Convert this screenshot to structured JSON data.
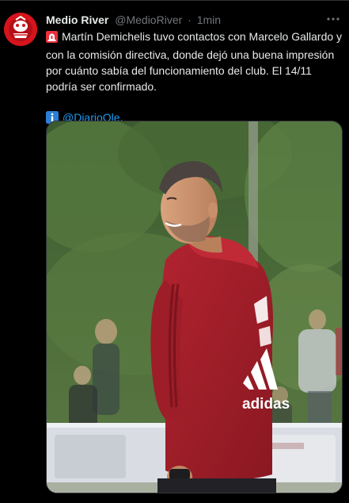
{
  "tweet": {
    "author": {
      "display_name": "Medio River",
      "handle": "@MedioRiver"
    },
    "separator": "·",
    "timestamp": "1min",
    "paragraph_1": "Martín Demichelis tuvo contactos con Marcelo Gallardo y con la comisión directiva, donde dejó una buena impresión por cuánto sabía del funcionamiento del club. El 14/11 podría ser confirmado.",
    "mention": "@DiarioOle",
    "mention_suffix": ".",
    "emojis": [
      "siren-emoji",
      "information-emoji"
    ],
    "media": {
      "description_icon": "photo",
      "jersey_brand_text": "adidas"
    }
  },
  "colors": {
    "background": "#000000",
    "text": "#e7e9ea",
    "secondary": "#71767b",
    "link": "#1d9bf0",
    "avatar": "#d5141c",
    "jersey": "#a5202c"
  }
}
